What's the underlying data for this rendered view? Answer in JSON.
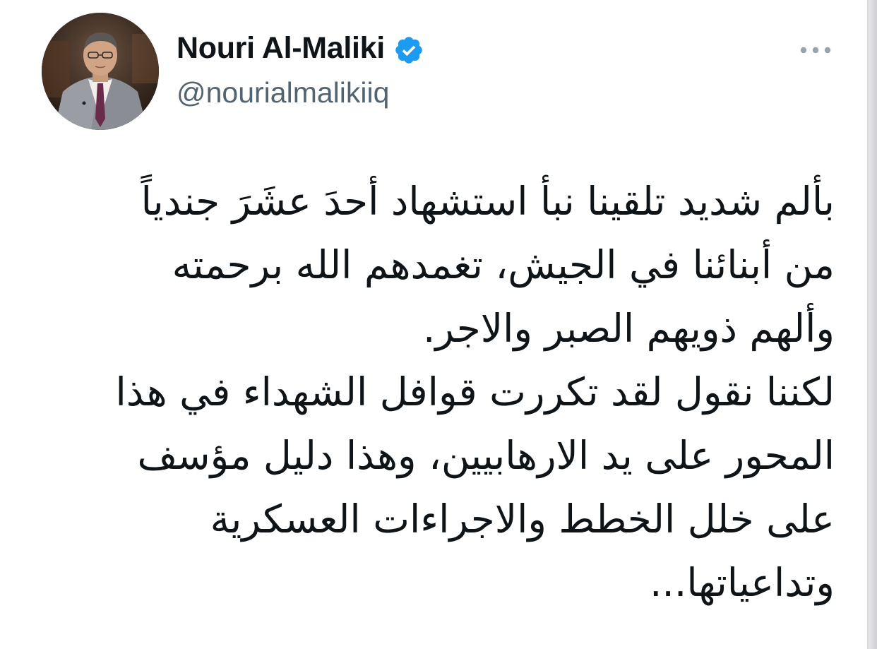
{
  "author": {
    "display_name": "Nouri Al-Maliki",
    "handle": "@nourialmalikiiq",
    "verified": true,
    "verified_color": "#1d9bf0",
    "avatar_icon": "profile-photo"
  },
  "menu": {
    "more_icon": "more-horizontal-icon"
  },
  "tweet": {
    "lines": [
      "بألم شديد تلقينا نبأ استشهاد أحدَ عشَرَ جندياً",
      "من أبنائنا في الجيش، تغمدهم الله برحمته",
      "وألهم ذويهم الصبر والاجر.",
      "لكننا نقول لقد تكررت قوافل الشهداء في هذا",
      "المحور على يد الارهابيين، وهذا دليل مؤسف",
      "على خلل الخطط والاجراءات العسكرية",
      "وتداعياتها..."
    ]
  },
  "colors": {
    "text_primary": "#0f1419",
    "text_secondary": "#536471",
    "background": "#ffffff"
  }
}
